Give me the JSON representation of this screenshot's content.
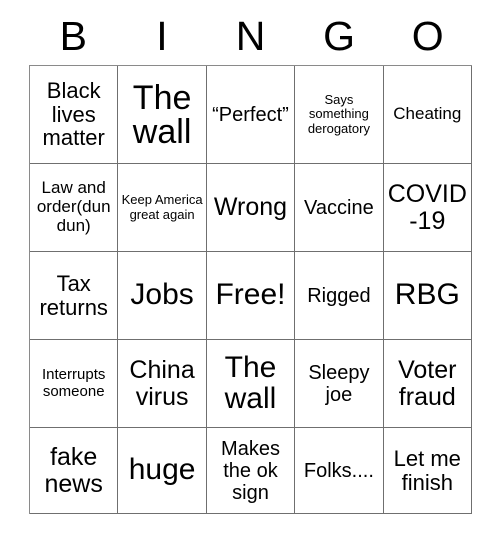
{
  "card": {
    "title": "BINGO",
    "header_letters": [
      "B",
      "I",
      "N",
      "G",
      "O"
    ],
    "colors": {
      "background": "#ffffff",
      "text": "#000000",
      "grid_line": "#6f6f6f"
    },
    "grid_size": "5x5",
    "rows": [
      [
        {
          "text": "Black lives matter",
          "size": "ml"
        },
        {
          "text": "The wall",
          "size": "xxl"
        },
        {
          "text": "“Perfect”",
          "size": "m"
        },
        {
          "text": "Says something derogatory",
          "size": "xs"
        },
        {
          "text": "Cheating",
          "size": "sm"
        }
      ],
      [
        {
          "text": "Law and order(dun dun)",
          "size": "sm"
        },
        {
          "text": "Keep America great again",
          "size": "xs"
        },
        {
          "text": "Wrong",
          "size": "l"
        },
        {
          "text": "Vaccine",
          "size": "m"
        },
        {
          "text": "COVID-19",
          "size": "l"
        }
      ],
      [
        {
          "text": "Tax returns",
          "size": "ml"
        },
        {
          "text": "Jobs",
          "size": "xl"
        },
        {
          "text": "Free!",
          "size": "xl"
        },
        {
          "text": "Rigged",
          "size": "m"
        },
        {
          "text": "RBG",
          "size": "xl"
        }
      ],
      [
        {
          "text": "Interrupts someone",
          "size": "s"
        },
        {
          "text": "China virus",
          "size": "l"
        },
        {
          "text": "The wall",
          "size": "xl"
        },
        {
          "text": "Sleepy joe",
          "size": "m"
        },
        {
          "text": "Voter fraud",
          "size": "l"
        }
      ],
      [
        {
          "text": "fake news",
          "size": "l"
        },
        {
          "text": "huge",
          "size": "xl"
        },
        {
          "text": "Makes the ok sign",
          "size": "m"
        },
        {
          "text": "Folks....",
          "size": "m"
        },
        {
          "text": "Let me finish",
          "size": "ml"
        }
      ]
    ]
  }
}
